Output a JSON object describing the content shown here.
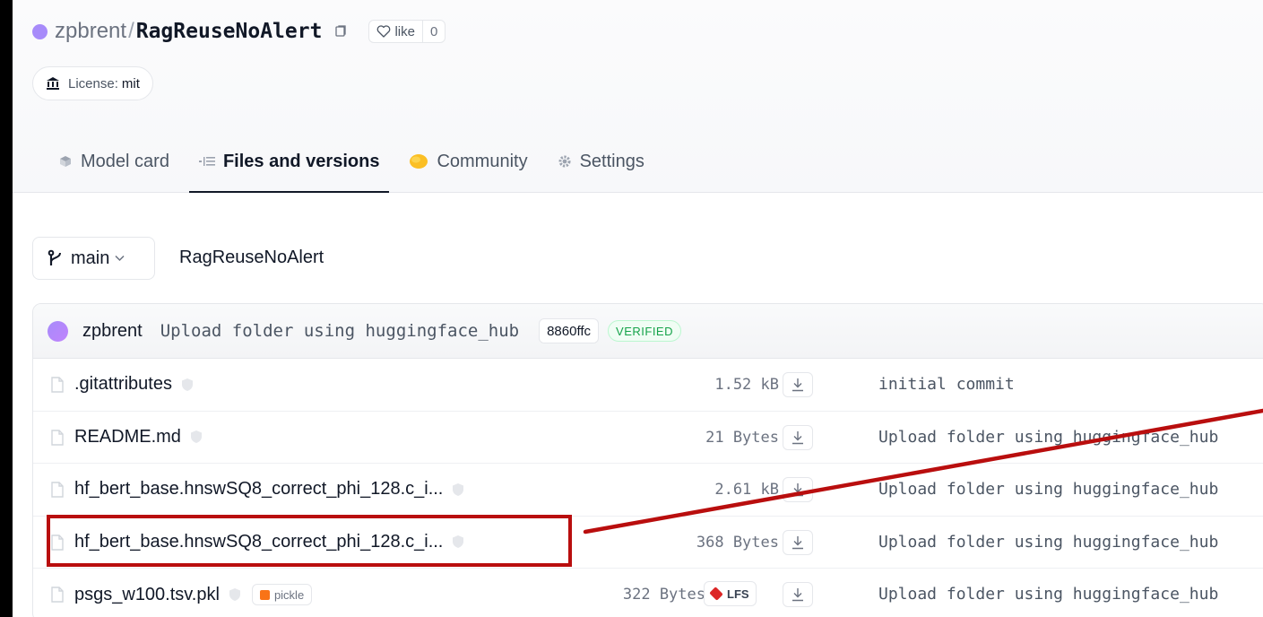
{
  "repo": {
    "owner": "zpbrent",
    "separator": "/",
    "name": "RagReuseNoAlert",
    "like_label": "like",
    "like_count": "0",
    "license_label": "License:",
    "license_value": "mit"
  },
  "tabs": [
    {
      "label": "Model card",
      "icon": "model-card-icon",
      "active": false
    },
    {
      "label": "Files and versions",
      "icon": "files-icon",
      "active": true
    },
    {
      "label": "Community",
      "icon": "community-icon",
      "active": false
    },
    {
      "label": "Settings",
      "icon": "gear-icon",
      "active": false
    }
  ],
  "branch": {
    "name": "main",
    "breadcrumb": "RagReuseNoAlert"
  },
  "last_commit": {
    "user": "zpbrent",
    "message": "Upload folder using huggingface_hub",
    "hash": "8860ffc",
    "status": "VERIFIED"
  },
  "files": [
    {
      "name": ".gitattributes",
      "size": "1.52 kB",
      "lfs": false,
      "pickle": false,
      "commit": "initial commit"
    },
    {
      "name": "README.md",
      "size": "21 Bytes",
      "lfs": false,
      "pickle": false,
      "commit": "Upload folder using huggingface_hub"
    },
    {
      "name": "hf_bert_base.hnswSQ8_correct_phi_128.c_i...",
      "size": "2.61 kB",
      "lfs": false,
      "pickle": false,
      "commit": "Upload folder using huggingface_hub"
    },
    {
      "name": "hf_bert_base.hnswSQ8_correct_phi_128.c_i...",
      "size": "368 Bytes",
      "lfs": false,
      "pickle": false,
      "commit": "Upload folder using huggingface_hub"
    },
    {
      "name": "psgs_w100.tsv.pkl",
      "size": "322 Bytes",
      "lfs": true,
      "lfs_label": "LFS",
      "pickle": true,
      "pickle_label": "pickle",
      "commit": "Upload folder using huggingface_hub"
    }
  ],
  "colors": {
    "accent_purple": "#a78bfa",
    "annotation_red": "#b90e0e",
    "verified_green": "#16a34a"
  }
}
